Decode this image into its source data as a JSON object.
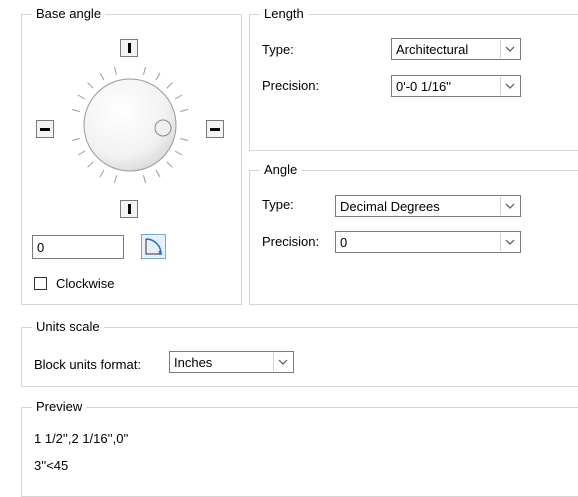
{
  "base_angle": {
    "title": "Base angle",
    "angle_value": "0",
    "clockwise_label": "Clockwise"
  },
  "length": {
    "title": "Length",
    "type_label": "Type:",
    "type_value": "Architectural",
    "precision_label": "Precision:",
    "precision_value": "0'-0 1/16''"
  },
  "angle": {
    "title": "Angle",
    "type_label": "Type:",
    "type_value": "Decimal Degrees",
    "precision_label": "Precision:",
    "precision_value": "0"
  },
  "units_scale": {
    "title": "Units scale",
    "block_units_label": "Block units format:",
    "block_units_value": "Inches"
  },
  "preview": {
    "title": "Preview",
    "line1": "1 1/2'',2 1/16'',0''",
    "line2": "3''<45"
  }
}
